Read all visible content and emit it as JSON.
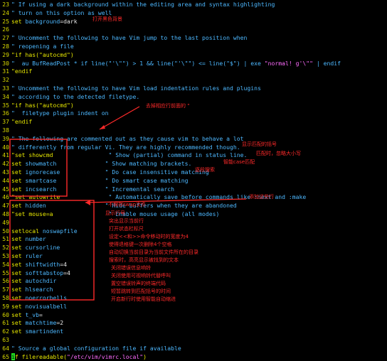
{
  "editor": {
    "lines": [
      {
        "n": "23",
        "segs": [
          [
            "cm",
            "\" If using a dark background within the editing area and syntax highlighting"
          ]
        ]
      },
      {
        "n": "24",
        "segs": [
          [
            "cm",
            "\" turn on this option as well"
          ]
        ]
      },
      {
        "n": "25",
        "segs": [
          [
            "kw",
            "set "
          ],
          [
            "cm",
            "background"
          ],
          [
            "pl",
            "=dark"
          ]
        ]
      },
      {
        "n": "26",
        "segs": []
      },
      {
        "n": "27",
        "segs": [
          [
            "cm",
            "\" Uncomment the following to have Vim jump to the last position when"
          ]
        ]
      },
      {
        "n": "28",
        "segs": [
          [
            "cm",
            "\" reopening a file"
          ]
        ]
      },
      {
        "n": "29",
        "segs": [
          [
            "kw",
            "\"if has(\"autocmd\")"
          ]
        ]
      },
      {
        "n": "30",
        "segs": [
          [
            "cm",
            "\"  au BufReadPost * if line(\"'\\\"\") > 1 && line(\"'\\\"\") <= line(\"$\") | exe "
          ],
          [
            "st",
            "\"normal! g'\\\"\""
          ],
          [
            "cm",
            " | endif"
          ]
        ]
      },
      {
        "n": "31",
        "segs": [
          [
            "kw",
            "\"endif"
          ]
        ]
      },
      {
        "n": "32",
        "segs": []
      },
      {
        "n": "33",
        "segs": [
          [
            "cm",
            "\" Uncomment the following to have Vim load indentation rules and plugins"
          ]
        ]
      },
      {
        "n": "34",
        "segs": [
          [
            "cm",
            "\" according to the detected filetype."
          ]
        ]
      },
      {
        "n": "35",
        "segs": [
          [
            "kw",
            "\"if has(\"autocmd\")"
          ]
        ]
      },
      {
        "n": "36",
        "segs": [
          [
            "cm",
            "\"  filetype plugin indent on"
          ]
        ]
      },
      {
        "n": "37",
        "segs": [
          [
            "kw",
            "\"endif"
          ]
        ]
      },
      {
        "n": "38",
        "segs": []
      },
      {
        "n": "39",
        "segs": [
          [
            "cm",
            "\" The following are commented out as they cause vim to behave a lot"
          ]
        ]
      },
      {
        "n": "40",
        "segs": [
          [
            "cm",
            "\" differently from regular Vi. They are highly recommended though."
          ]
        ]
      },
      {
        "n": "41",
        "segs": [
          [
            "kw",
            "\"set showcmd"
          ],
          [
            "cm",
            "                \" Show (partial) command in status line."
          ]
        ]
      },
      {
        "n": "42",
        "segs": [
          [
            "kw",
            "set "
          ],
          [
            "cm",
            "showmatch"
          ],
          [
            "cm",
            "              \" Show matching brackets."
          ]
        ]
      },
      {
        "n": "43",
        "segs": [
          [
            "kw",
            "set "
          ],
          [
            "cm",
            "ignorecase"
          ],
          [
            "cm",
            "             \" Do case insensitive matching"
          ]
        ]
      },
      {
        "n": "44",
        "segs": [
          [
            "kw",
            "set "
          ],
          [
            "cm",
            "smartcase"
          ],
          [
            "cm",
            "              \" Do smart case matching"
          ]
        ]
      },
      {
        "n": "45",
        "segs": [
          [
            "kw",
            "set "
          ],
          [
            "cm",
            "incsearch"
          ],
          [
            "cm",
            "              \" Incremental search"
          ]
        ]
      },
      {
        "n": "46",
        "segs": [
          [
            "kw",
            "\"set autowrite"
          ],
          [
            "cm",
            "              \" Automatically save before commands like :next and :make"
          ]
        ]
      },
      {
        "n": "47",
        "segs": [
          [
            "kw",
            "set "
          ],
          [
            "cm",
            "hidden"
          ],
          [
            "cm",
            "                 \" Hide buffers when they are abandoned"
          ]
        ]
      },
      {
        "n": "48",
        "segs": [
          [
            "kw",
            "\"set mouse=a"
          ],
          [
            "cm",
            "                \" Enable mouse usage (all modes)"
          ]
        ]
      },
      {
        "n": "49",
        "segs": []
      },
      {
        "n": "50",
        "segs": [
          [
            "kw",
            "setlocal "
          ],
          [
            "cm",
            "noswapfile"
          ]
        ]
      },
      {
        "n": "51",
        "segs": [
          [
            "kw",
            "set "
          ],
          [
            "cm",
            "number"
          ]
        ]
      },
      {
        "n": "52",
        "segs": [
          [
            "kw",
            "set "
          ],
          [
            "cm",
            "cursorline"
          ]
        ]
      },
      {
        "n": "53",
        "segs": [
          [
            "kw",
            "set "
          ],
          [
            "cm",
            "ruler"
          ]
        ]
      },
      {
        "n": "54",
        "segs": [
          [
            "kw",
            "set "
          ],
          [
            "cm",
            "shiftwidth"
          ],
          [
            "pl",
            "=4"
          ]
        ]
      },
      {
        "n": "55",
        "segs": [
          [
            "kw",
            "set "
          ],
          [
            "cm",
            "softtabstop"
          ],
          [
            "pl",
            "=4"
          ]
        ]
      },
      {
        "n": "56",
        "segs": [
          [
            "kw",
            "set "
          ],
          [
            "cm",
            "autochdir"
          ]
        ]
      },
      {
        "n": "57",
        "segs": [
          [
            "kw",
            "set "
          ],
          [
            "cm",
            "hlsearch"
          ]
        ]
      },
      {
        "n": "58",
        "segs": [
          [
            "kw",
            "set "
          ],
          [
            "cm",
            "noerrorbells"
          ]
        ]
      },
      {
        "n": "59",
        "segs": [
          [
            "kw",
            "set "
          ],
          [
            "cm",
            "novisualbell"
          ]
        ]
      },
      {
        "n": "60",
        "segs": [
          [
            "kw",
            "set "
          ],
          [
            "cm",
            "t_vb"
          ],
          [
            "pl",
            "="
          ]
        ]
      },
      {
        "n": "61",
        "segs": [
          [
            "kw",
            "set "
          ],
          [
            "cm",
            "matchtime"
          ],
          [
            "pl",
            "=2"
          ]
        ]
      },
      {
        "n": "62",
        "segs": [
          [
            "kw",
            "set "
          ],
          [
            "cm",
            "smartindent"
          ]
        ]
      },
      {
        "n": "63",
        "segs": []
      },
      {
        "n": "64",
        "segs": [
          [
            "cm",
            "\" Source a global configuration file if available"
          ]
        ]
      },
      {
        "n": "65",
        "segs": [
          [
            "cursor",
            "i"
          ],
          [
            "kw",
            "f filereadable("
          ],
          [
            "st",
            "\"/etc/vim/vimrc.local\""
          ],
          [
            "kw",
            ")"
          ]
        ]
      }
    ]
  },
  "annotations": {
    "open_dark_bg": "打开黑色背景",
    "remove_quote": "去掉相应行前面的 \"",
    "show_match_brackets": "显示匹配的括号",
    "ignore_case": "匹配时，忽略大小写",
    "smart_case": "智能case匹配",
    "inc_search": "逐段搜索",
    "add_these_lines": "添加这些行",
    "no_swap": "不保存swap文件",
    "show_number": "显示行号",
    "cursorline": "突出显示当前行",
    "ruler": "打开状态栏标尺",
    "shiftwidth": "设定<<和>>命令移动时的宽度为4",
    "softtabstop": "使得退格键一次删除4个空格",
    "autochdir": "自动切换当前目录为当前文件所在的目录",
    "hlsearch": "搜索时，高亮显示被找到的文本",
    "noerrorbells": "关闭错误信息响铃",
    "novisualbell": "关闭使用可视响铃代替呼叫",
    "t_vb": "置空错误铃声的终端代码",
    "matchtime": "短暂跳转到匹配括号的时间",
    "smartindent": "开启新行时使用智能自动缩进"
  },
  "colors": {
    "background": "#000000",
    "line_number": "#d8d800",
    "keyword": "#e8e800",
    "comment": "#4db8ff",
    "string": "#ff6cff",
    "cursor": "#20e020",
    "annotation": "#ff2a2a"
  }
}
